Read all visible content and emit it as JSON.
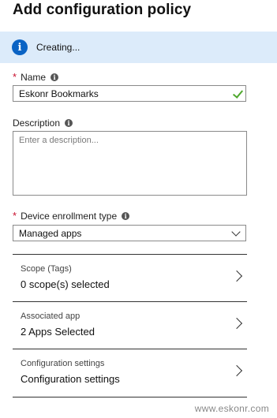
{
  "page": {
    "title": "Add configuration policy"
  },
  "banner": {
    "icon": "info-icon",
    "text": "Creating..."
  },
  "name_field": {
    "label": "Name",
    "required_mark": "*",
    "value": "Eskonr Bookmarks",
    "valid_icon": "checkmark-icon"
  },
  "description_field": {
    "label": "Description",
    "placeholder": "Enter a description..."
  },
  "enrollment_field": {
    "label": "Device enrollment type",
    "required_mark": "*",
    "selected": "Managed apps"
  },
  "rows": [
    {
      "caption": "Scope (Tags)",
      "value": "0 scope(s) selected"
    },
    {
      "caption": "Associated app",
      "value": "2 Apps Selected"
    },
    {
      "caption": "Configuration settings",
      "value": "Configuration settings"
    }
  ],
  "watermark": "www.eskonr.com",
  "colors": {
    "banner_bg": "#dcebfa",
    "info_blue": "#0a63c4",
    "required_red": "#c8102e",
    "valid_green": "#4fa82e"
  }
}
